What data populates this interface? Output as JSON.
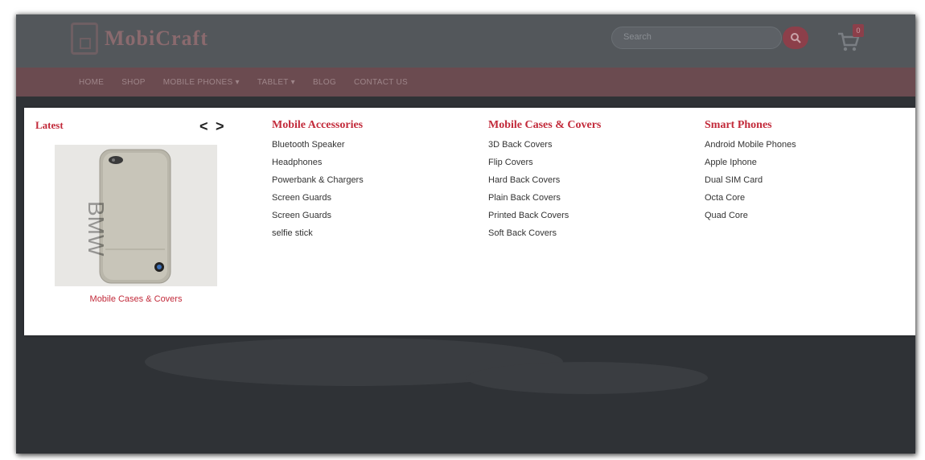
{
  "brand": {
    "name": "MobiCraft"
  },
  "search": {
    "placeholder": "Search"
  },
  "cart": {
    "count": "0"
  },
  "nav": {
    "items": [
      "HOME",
      "SHOP",
      "MOBILE PHONES ▾",
      "TABLET ▾",
      "BLOG",
      "CONTACT US"
    ]
  },
  "mega_menu": {
    "latest_label": "Latest",
    "prev_arrow": "<",
    "next_arrow": ">",
    "product_caption": "Mobile Cases & Covers",
    "columns": [
      {
        "title": "Mobile Accessories",
        "links": [
          "Bluetooth Speaker",
          "Headphones",
          "Powerbank & Chargers",
          "Screen Guards",
          "Screen Guards",
          "selfie stick"
        ]
      },
      {
        "title": "Mobile Cases & Covers",
        "links": [
          "3D Back Covers",
          "Flip Covers",
          "Hard Back Covers",
          "Plain Back Covers",
          "Printed Back Covers",
          "Soft Back Covers"
        ]
      },
      {
        "title": "Smart Phones",
        "links": [
          "Android Mobile Phones",
          "Apple Iphone",
          "Dual SIM Card",
          "Octa Core",
          "Quad Core"
        ]
      }
    ]
  },
  "icons": {
    "logo": "phone-logo-icon",
    "search": "search-icon",
    "cart": "cart-icon",
    "prev": "chevron-left-icon",
    "next": "chevron-right-icon"
  },
  "colors": {
    "accent": "#c22a3a",
    "nav_bg": "#6b4b50",
    "header_bg": "#53575b",
    "overlay_bg": "#3c3f43"
  }
}
